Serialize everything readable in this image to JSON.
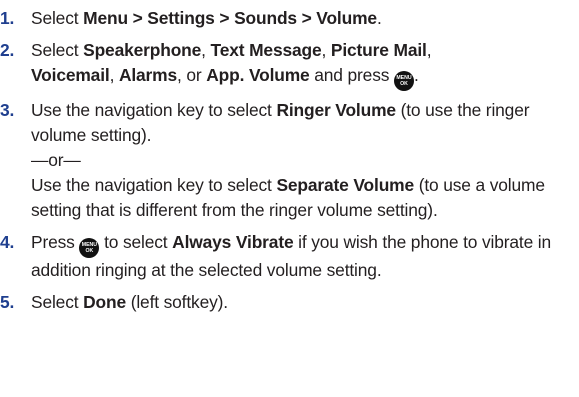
{
  "steps": [
    {
      "number": "1.",
      "t1": "Select ",
      "b1": "Menu > Settings > Sounds > Volume",
      "t2": "."
    },
    {
      "number": "2.",
      "t1": "Select ",
      "b1": "Speakerphone",
      "t2": ", ",
      "b2": "Text Message",
      "t3": ", ",
      "b3": "Picture Mail",
      "t4": ",",
      "b4": "Voicemail",
      "t5": ", ",
      "b5": "Alarms",
      "t6": ", or ",
      "b6": "App. Volume",
      "t7": " and press ",
      "t8": "."
    },
    {
      "number": "3.",
      "t1": "Use the navigation key to select ",
      "b1": "Ringer Volume",
      "t2": " (to use the ringer volume setting).",
      "or": "—or—",
      "t3": "Use the navigation key to select ",
      "b2": "Separate Volume",
      "t4": " (to use a volume setting that is different from the ringer volume setting)."
    },
    {
      "number": "4.",
      "t1": "Press ",
      "t2": " to select ",
      "b1": "Always Vibrate",
      "t3": " if you wish the phone to vibrate in addition ringing at the selected volume setting."
    },
    {
      "number": "5.",
      "t1": "Select ",
      "b1": "Done",
      "t2": " (left softkey)."
    }
  ],
  "menu_key": {
    "line1": "MENU",
    "line2": "OK",
    "icon": "menu-ok-key-icon"
  },
  "colors": {
    "number": "#1f3f8f",
    "text": "#231f20",
    "key": "#111111"
  }
}
